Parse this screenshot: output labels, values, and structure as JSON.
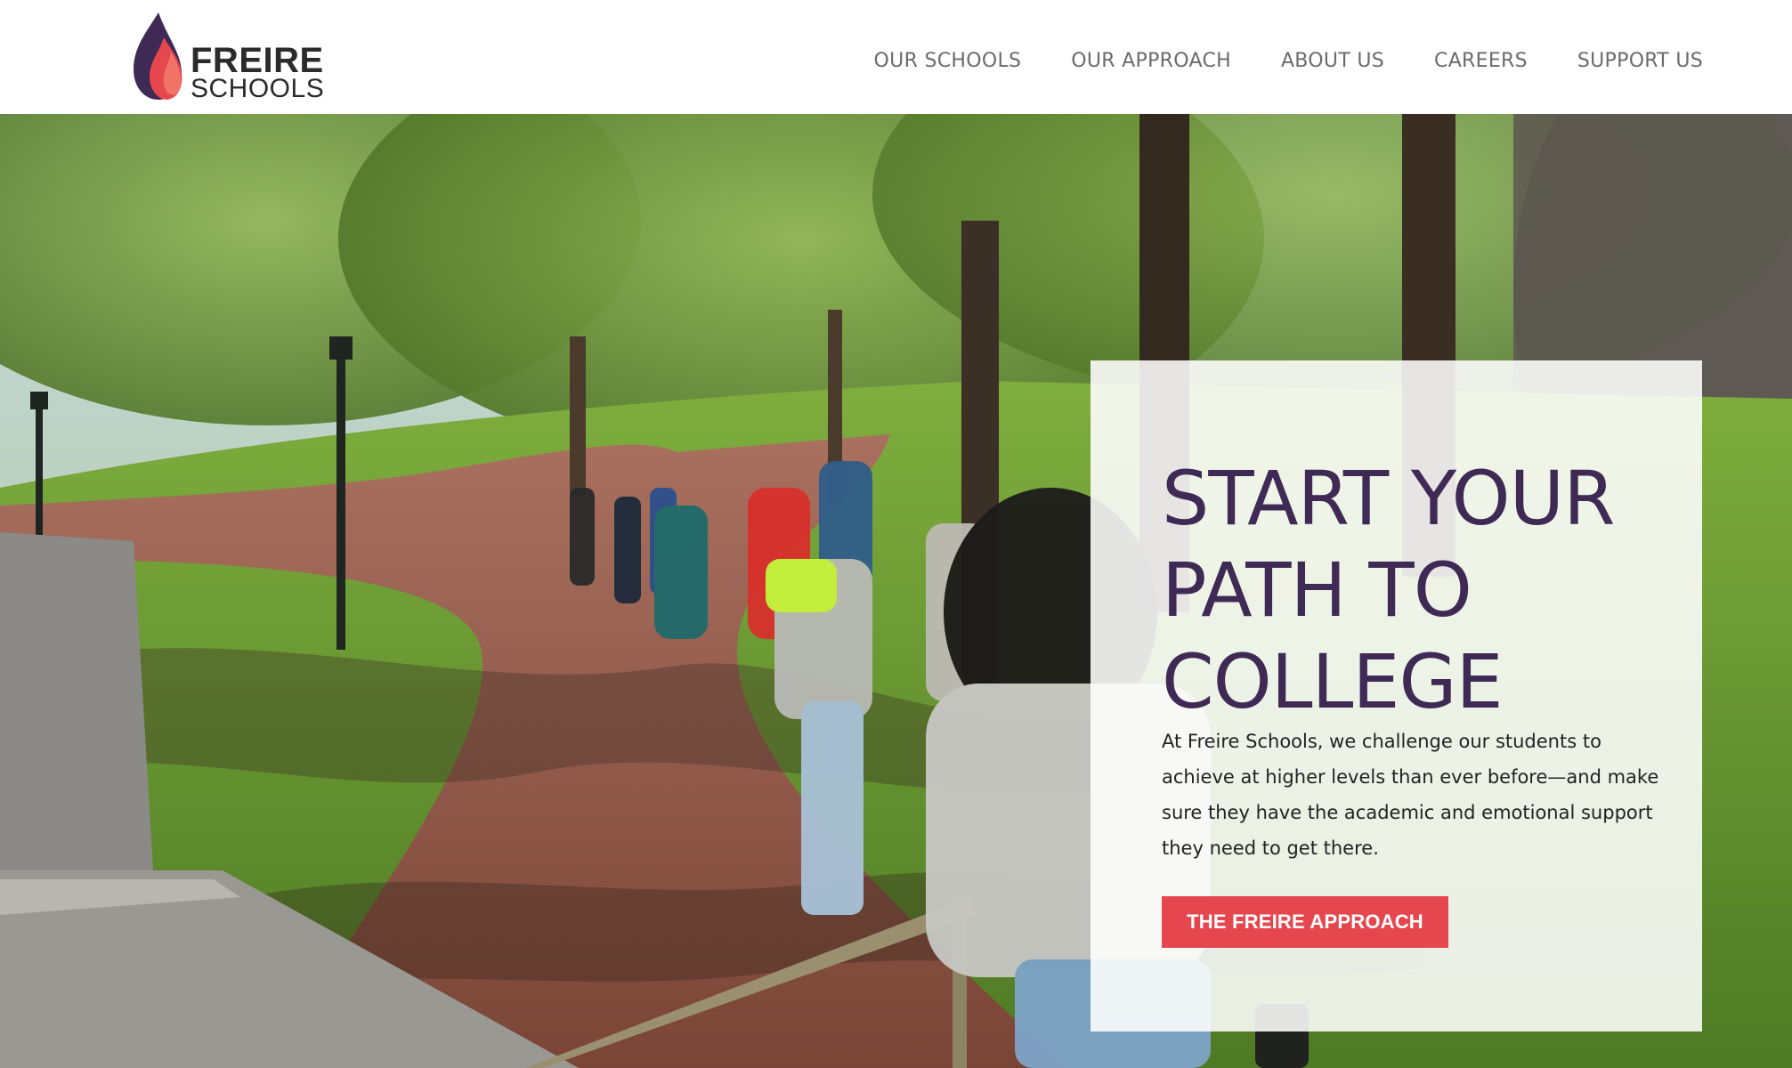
{
  "brand": {
    "name_line1": "FREIRE",
    "name_line2": "SCHOOLS",
    "colors": {
      "flame_purple": "#3f2a55",
      "flame_coral": "#e6474f",
      "flame_orange": "#f2786a"
    }
  },
  "nav": {
    "items": [
      {
        "label": "OUR SCHOOLS"
      },
      {
        "label": "OUR APPROACH"
      },
      {
        "label": "ABOUT US"
      },
      {
        "label": "CAREERS"
      },
      {
        "label": "SUPPORT US"
      }
    ]
  },
  "hero": {
    "headline_lines": [
      "START YOUR",
      "PATH TO",
      "COLLEGE"
    ],
    "intro": "At Freire Schools, we challenge our students to achieve at higher levels than ever before—and make sure they have the academic and emotional support they need to get there.",
    "cta_label": "THE FREIRE APPROACH",
    "colors": {
      "headline": "#3f2a55",
      "cta_background": "#e6474f",
      "card_background": "#ffffff"
    }
  }
}
